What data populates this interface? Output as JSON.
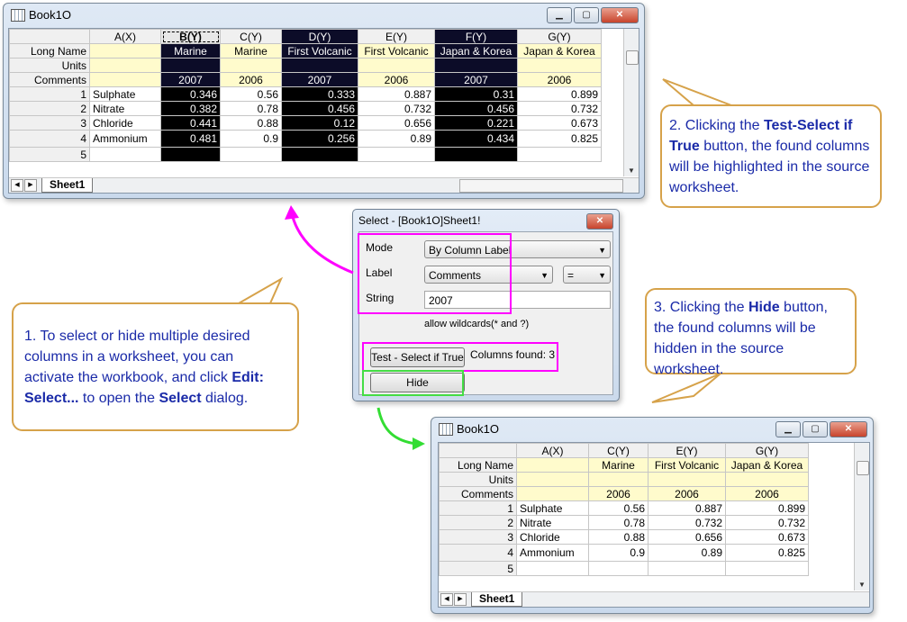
{
  "top_window": {
    "title": "Book1O",
    "columns": [
      "A(X)",
      "B(Y)",
      "C(Y)",
      "D(Y)",
      "E(Y)",
      "F(Y)",
      "G(Y)"
    ],
    "row_labels": [
      "Long Name",
      "Units",
      "Comments"
    ],
    "long_names": [
      "",
      "Marine",
      "Marine",
      "First Volcanic",
      "First Volcanic",
      "Japan & Korea",
      "Japan & Korea"
    ],
    "units": [
      "",
      "",
      "",
      "",
      "",
      "",
      ""
    ],
    "comments": [
      "",
      "2007",
      "2006",
      "2007",
      "2006",
      "2007",
      "2006"
    ],
    "rows": [
      {
        "n": "1",
        "cells": [
          "Sulphate",
          "0.346",
          "0.56",
          "0.333",
          "0.887",
          "0.31",
          "0.899"
        ]
      },
      {
        "n": "2",
        "cells": [
          "Nitrate",
          "0.382",
          "0.78",
          "0.456",
          "0.732",
          "0.456",
          "0.732"
        ]
      },
      {
        "n": "3",
        "cells": [
          "Chloride",
          "0.441",
          "0.88",
          "0.12",
          "0.656",
          "0.221",
          "0.673"
        ]
      },
      {
        "n": "4",
        "cells": [
          "Ammonium",
          "0.481",
          "0.9",
          "0.256",
          "0.89",
          "0.434",
          "0.825"
        ]
      },
      {
        "n": "5",
        "cells": [
          "",
          "",
          "",
          "",
          "",
          "",
          ""
        ]
      }
    ],
    "sheet_tab": "Sheet1"
  },
  "dialog": {
    "title": "Select - [Book1O]Sheet1!",
    "close_label": "✕",
    "mode_label": "Mode",
    "mode_value": "By Column Label",
    "label_label": "Label",
    "label_value": "Comments",
    "operator_value": "=",
    "string_label": "String",
    "string_value": "2007",
    "wildcards_note": "allow wildcards(* and ?)",
    "test_button": "Test - Select if True",
    "columns_found": "Columns found: 3",
    "hide_button": "Hide"
  },
  "bottom_window": {
    "title": "Book1O",
    "columns": [
      "A(X)",
      "C(Y)",
      "E(Y)",
      "G(Y)"
    ],
    "long_names": [
      "",
      "Marine",
      "First Volcanic",
      "Japan & Korea"
    ],
    "units": [
      "",
      "",
      "",
      ""
    ],
    "comments": [
      "",
      "2006",
      "2006",
      "2006"
    ],
    "rows": [
      {
        "n": "1",
        "cells": [
          "Sulphate",
          "0.56",
          "0.887",
          "0.899"
        ]
      },
      {
        "n": "2",
        "cells": [
          "Nitrate",
          "0.78",
          "0.732",
          "0.732"
        ]
      },
      {
        "n": "3",
        "cells": [
          "Chloride",
          "0.88",
          "0.656",
          "0.673"
        ]
      },
      {
        "n": "4",
        "cells": [
          "Ammonium",
          "0.9",
          "0.89",
          "0.825"
        ]
      },
      {
        "n": "5",
        "cells": [
          "",
          "",
          "",
          ""
        ]
      }
    ],
    "sheet_tab": "Sheet1"
  },
  "callouts": {
    "c1_pre": "1. To select or hide multiple desired columns in a worksheet, you can activate the workbook, and click ",
    "c1_b1": "Edit: Select...",
    "c1_mid": " to open the ",
    "c1_b2": "Select",
    "c1_post": " dialog.",
    "c2_pre": "2. Clicking the ",
    "c2_b": "Test-Select if True",
    "c2_post": " button, the found columns will be highlighted in the source worksheet.",
    "c3_pre": "3. Clicking the ",
    "c3_b": "Hide",
    "c3_post": " button, the found columns will be hidden in the source worksheet."
  },
  "colors": {
    "callout_border": "#d6a24a",
    "callout_text": "#1a2aa8",
    "highlight_magenta": "#ff00ff",
    "highlight_green": "#44dd44",
    "selected_column": "#000000"
  }
}
